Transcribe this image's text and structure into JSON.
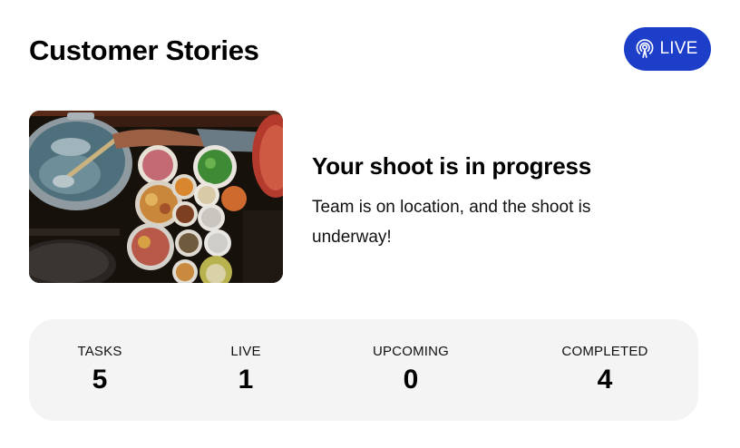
{
  "header": {
    "title": "Customer Stories",
    "live_badge": {
      "icon": "broadcast-icon",
      "label": "LIVE",
      "color": "#1d3ec9"
    }
  },
  "story": {
    "image_icon": "street-food-photo",
    "heading": "Your shoot is in progress",
    "text": "Team is on location, and the shoot is underway!"
  },
  "stats": [
    {
      "label": "TASKS",
      "value": "5"
    },
    {
      "label": "LIVE",
      "value": "1"
    },
    {
      "label": "UPCOMING",
      "value": "0"
    },
    {
      "label": "COMPLETED",
      "value": "4"
    }
  ]
}
